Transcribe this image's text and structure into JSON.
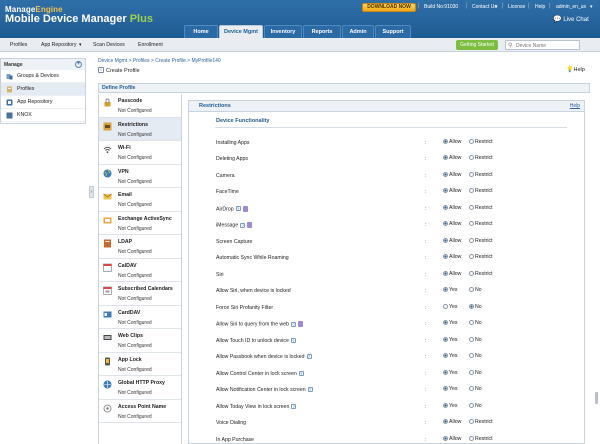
{
  "header": {
    "brand_top_a": "Manage",
    "brand_top_b": "Engine",
    "brand_main": "Mobile Device Manager",
    "brand_plus": "Plus",
    "download_label": "DOWNLOAD NOW",
    "build": "Build No:91030",
    "contact": "Contact Us",
    "license": "License",
    "help": "Help",
    "user": "admin_en_us",
    "live_chat": "Live Chat",
    "tabs": [
      "Home",
      "Device Mgmt",
      "Inventory",
      "Reports",
      "Admin",
      "Support"
    ]
  },
  "subnav": {
    "items": [
      "Profiles",
      "App Repository",
      "Scan Devices",
      "Enrollment"
    ],
    "getting_started": "Getting Started",
    "search_placeholder": "Device Name"
  },
  "sidebar": {
    "title": "Manage",
    "items": [
      "Groups & Devices",
      "Profiles",
      "App Repository",
      "KNOX"
    ]
  },
  "breadcrumb": "Device Mgmt > Profiles > Create Profile > MyProfile140",
  "page_title": "Create Profile",
  "help_label": "Help",
  "define_profile": "Define Profile",
  "payloads": [
    {
      "name": "Passcode",
      "status": "Not Configured"
    },
    {
      "name": "Restrictions",
      "status": "Not Configured"
    },
    {
      "name": "Wi-Fi",
      "status": "Not Configured"
    },
    {
      "name": "VPN",
      "status": "Not Configured"
    },
    {
      "name": "Email",
      "status": "Not Configured"
    },
    {
      "name": "Exchange ActiveSync",
      "status": "Not Configured"
    },
    {
      "name": "LDAP",
      "status": "Not Configured"
    },
    {
      "name": "CalDAV",
      "status": "Not Configured"
    },
    {
      "name": "Subscribed Calendars",
      "status": "Not Configured"
    },
    {
      "name": "CardDAV",
      "status": "Not Configured"
    },
    {
      "name": "Web Clips",
      "status": "Not Configured"
    },
    {
      "name": "App Lock",
      "status": "Not Configured"
    },
    {
      "name": "Global HTTP Proxy",
      "status": "Not Configured"
    },
    {
      "name": "Access Point Name",
      "status": "Not Configured"
    }
  ],
  "restrictions": {
    "title": "Restrictions",
    "help": "Help",
    "section": "Device Functionality",
    "colon": ":",
    "allow": "Allow",
    "restrict": "Restrict",
    "yes": "Yes",
    "no": "No",
    "rows": [
      {
        "label": "Installing Apps",
        "kind": "ar",
        "value": "Allow"
      },
      {
        "label": "Deleting Apps",
        "kind": "ar",
        "value": "Allow"
      },
      {
        "label": "Camera",
        "kind": "ar",
        "value": "Allow"
      },
      {
        "label": "FaceTime",
        "kind": "ar",
        "value": "Allow"
      },
      {
        "label": "AirDrop",
        "kind": "ar",
        "value": "Allow"
      },
      {
        "label": "iMessage",
        "kind": "ar",
        "value": "Allow"
      },
      {
        "label": "Screen Capture",
        "kind": "ar",
        "value": "Allow"
      },
      {
        "label": "Automatic Sync While Roaming",
        "kind": "ar",
        "value": "Allow"
      },
      {
        "label": "Siri",
        "kind": "ar",
        "value": "Allow"
      },
      {
        "label": "Allow Siri, when device is locked",
        "kind": "yn",
        "value": "Yes"
      },
      {
        "label": "Force Siri Profanity Filter",
        "kind": "yn",
        "value": "No"
      },
      {
        "label": "Allow Siri to query from the web",
        "kind": "yn",
        "value": "Yes"
      },
      {
        "label": "Allow Touch ID to unlock device",
        "kind": "yn",
        "value": "Yes"
      },
      {
        "label": "Allow Passbook when device is locked",
        "kind": "yn",
        "value": "Yes"
      },
      {
        "label": "Allow Control Center in lock screen",
        "kind": "yn",
        "value": "Yes"
      },
      {
        "label": "Allow Notification Center in lock screen",
        "kind": "yn",
        "value": "Yes"
      },
      {
        "label": "Allow Today View in lock screen",
        "kind": "yn",
        "value": "Yes"
      },
      {
        "label": "Voice Dialing",
        "kind": "ar",
        "value": "Allow"
      },
      {
        "label": "In App Purchase",
        "kind": "ar",
        "value": "Allow"
      }
    ]
  }
}
